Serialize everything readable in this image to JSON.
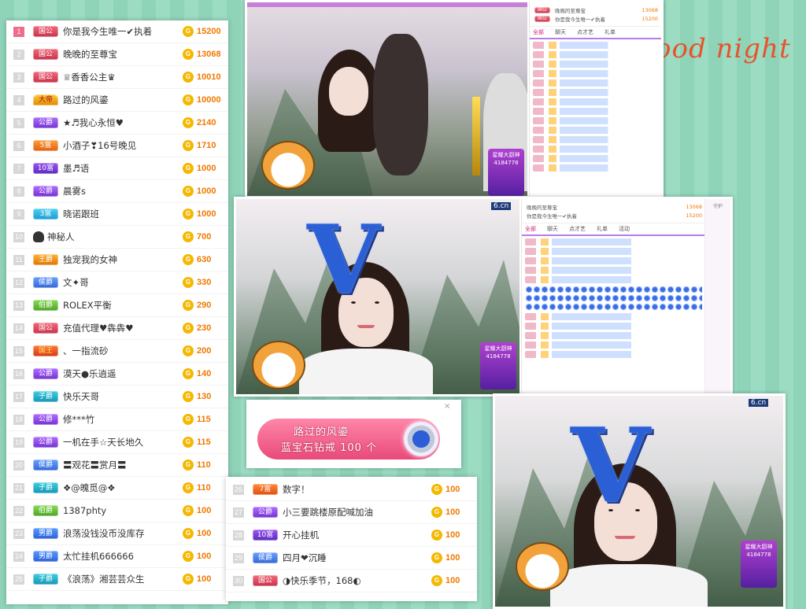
{
  "decor_text": "ood night",
  "ranking_main": [
    {
      "rank": "1",
      "badge": "国公",
      "badge_class": "b-guogong",
      "name": "你是我今生唯一✔执着",
      "amount": "15200",
      "top": true
    },
    {
      "rank": "2",
      "badge": "国公",
      "badge_class": "b-guogong",
      "name": "晚晚的至尊宝",
      "amount": "13068",
      "top": false
    },
    {
      "rank": "3",
      "badge": "国公",
      "badge_class": "b-guogong",
      "name": "♕香香公主♛",
      "amount": "10010",
      "top": false
    },
    {
      "rank": "4",
      "badge": "大帝",
      "badge_class": "b-dashi",
      "name": "路过的风鎏",
      "amount": "10000",
      "top": false
    },
    {
      "rank": "5",
      "badge": "公爵",
      "badge_class": "b-gongjue",
      "name": "★♬我心永恒♥",
      "amount": "2140",
      "top": false
    },
    {
      "rank": "6",
      "badge": "5富",
      "badge_class": "b-fu5",
      "name": "小酒子❣16号晚见",
      "amount": "1710",
      "top": false
    },
    {
      "rank": "7",
      "badge": "10富",
      "badge_class": "b-fu10",
      "name": "墨♬语",
      "amount": "1000",
      "top": false
    },
    {
      "rank": "8",
      "badge": "公爵",
      "badge_class": "b-gongjue",
      "name": "晨雾s",
      "amount": "1000",
      "top": false
    },
    {
      "rank": "9",
      "badge": "3富",
      "badge_class": "b-fu3",
      "name": "晓诺跟班",
      "amount": "1000",
      "top": false
    },
    {
      "rank": "10",
      "badge": "",
      "badge_class": "",
      "name": "神秘人",
      "amount": "700",
      "top": false
    },
    {
      "rank": "11",
      "badge": "王爵",
      "badge_class": "b-wangjue",
      "name": "独宠我的女神",
      "amount": "630",
      "top": false
    },
    {
      "rank": "12",
      "badge": "侯爵",
      "badge_class": "b-houjue",
      "name": "文✦哥",
      "amount": "330",
      "top": false
    },
    {
      "rank": "13",
      "badge": "伯爵",
      "badge_class": "b-bojue",
      "name": "ROLEX平衡",
      "amount": "290",
      "top": false
    },
    {
      "rank": "14",
      "badge": "国公",
      "badge_class": "b-guogong",
      "name": "充值代理♥犇犇♥",
      "amount": "230",
      "top": false
    },
    {
      "rank": "15",
      "badge": "国王",
      "badge_class": "b-guowang",
      "name": "、一指流砂",
      "amount": "200",
      "top": false
    },
    {
      "rank": "16",
      "badge": "公爵",
      "badge_class": "b-gongjue",
      "name": "漠天●乐逍遥",
      "amount": "140",
      "top": false
    },
    {
      "rank": "17",
      "badge": "子爵",
      "badge_class": "b-zijue",
      "name": "快乐天哥",
      "amount": "130",
      "top": false
    },
    {
      "rank": "18",
      "badge": "公爵",
      "badge_class": "b-gongjue",
      "name": "修***竹",
      "amount": "115",
      "top": false
    },
    {
      "rank": "19",
      "badge": "公爵",
      "badge_class": "b-gongjue",
      "name": "一机在手☆天长地久",
      "amount": "115",
      "top": false
    },
    {
      "rank": "20",
      "badge": "侯爵",
      "badge_class": "b-houjue",
      "name": "〓观花〓赏月〓",
      "amount": "110",
      "top": false
    },
    {
      "rank": "21",
      "badge": "子爵",
      "badge_class": "b-zijue",
      "name": "❖@魄觅@❖",
      "amount": "110",
      "top": false
    },
    {
      "rank": "22",
      "badge": "伯爵",
      "badge_class": "b-bojue",
      "name": "1387phty",
      "amount": "100",
      "top": false
    },
    {
      "rank": "23",
      "badge": "男爵",
      "badge_class": "b-nanjue",
      "name": "浪荡没钱没币没库存",
      "amount": "100",
      "top": false
    },
    {
      "rank": "24",
      "badge": "男爵",
      "badge_class": "b-nanjue",
      "name": "太忙挂机666666",
      "amount": "100",
      "top": false
    },
    {
      "rank": "25",
      "badge": "子爵",
      "badge_class": "b-zijue",
      "name": "《浪荡》湘芸芸众生",
      "amount": "100",
      "top": false
    }
  ],
  "ranking_bottom": [
    {
      "rank": "26",
      "badge": "7富",
      "badge_class": "b-fu7",
      "name": "数字！",
      "amount": "100"
    },
    {
      "rank": "27",
      "badge": "公爵",
      "badge_class": "b-gongjue",
      "name": "小三要跳楼原配喊加油",
      "amount": "100"
    },
    {
      "rank": "28",
      "badge": "10富",
      "badge_class": "b-fu10",
      "name": "开心挂机",
      "amount": "100"
    },
    {
      "rank": "29",
      "badge": "侯爵",
      "badge_class": "b-houjue",
      "name": "四月❤沉睡",
      "amount": "100"
    },
    {
      "rank": "30",
      "badge": "国公",
      "badge_class": "b-guogong",
      "name": "◑快乐季节，168◐",
      "amount": "100"
    }
  ],
  "coin_glyph": "G",
  "stream": {
    "site_logo": "6.cn",
    "chat_tabs": [
      "全部",
      "聊天",
      "点才艺",
      "礼单",
      "活动"
    ],
    "top_label": "本场\n榜单",
    "top_rows": [
      {
        "name": "晚晚的至尊宝",
        "amount": "13068"
      },
      {
        "name": "你是我今生唯一✔执着",
        "amount": "15200"
      }
    ],
    "gift_box_title": "星耀大厨神",
    "gift_box_sub": "4184778",
    "side_label": "守护"
  },
  "banner": {
    "line1": "路过的风鎏",
    "line2": "蓝宝石钻戒 100 个",
    "close": "×"
  }
}
